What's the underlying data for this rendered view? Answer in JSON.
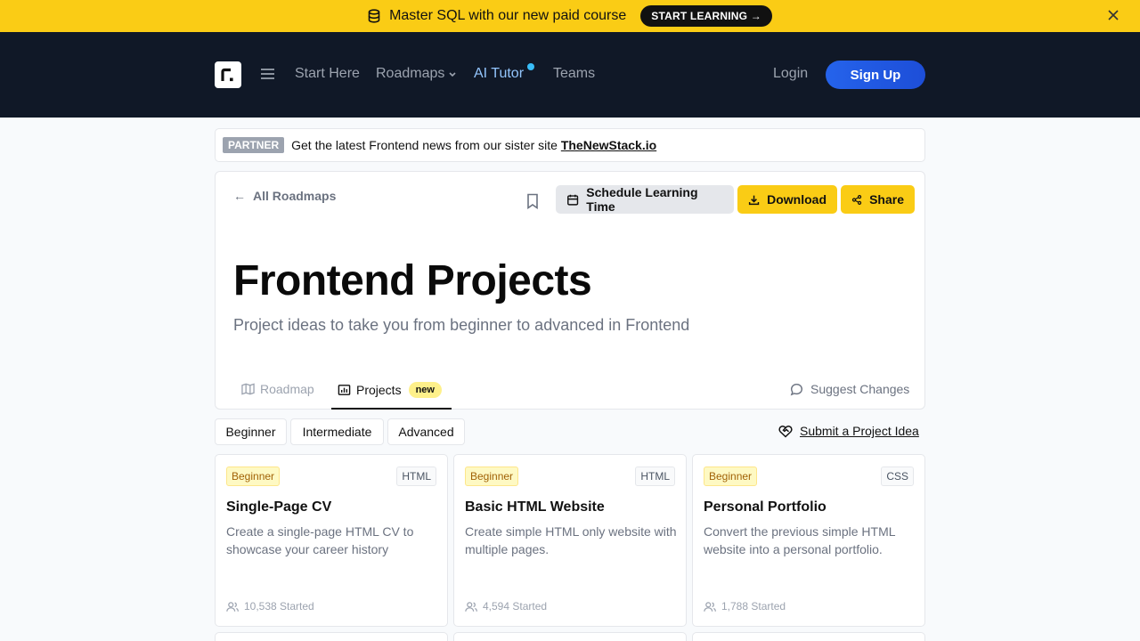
{
  "promo": {
    "text": "Master SQL with our new paid course",
    "button": "START LEARNING →"
  },
  "nav": {
    "links": [
      "Start Here",
      "Roadmaps",
      "AI Tutor",
      "Teams"
    ],
    "login": "Login",
    "signup": "Sign Up"
  },
  "partner": {
    "badge": "PARTNER",
    "text": "Get the latest Frontend news from our sister site ",
    "link": "TheNewStack.io"
  },
  "header": {
    "back": "All Roadmaps",
    "schedule": "Schedule Learning Time",
    "download": "Download",
    "share": "Share",
    "title": "Frontend Projects",
    "subtitle": "Project ideas to take you from beginner to advanced in Frontend"
  },
  "tabs": {
    "roadmap": "Roadmap",
    "projects": "Projects",
    "new_badge": "new",
    "suggest": "Suggest Changes"
  },
  "filters": [
    "Beginner",
    "Intermediate",
    "Advanced"
  ],
  "submit_idea": "Submit a Project Idea",
  "projects": [
    {
      "level": "Beginner",
      "tech": "HTML",
      "title": "Single-Page CV",
      "desc": "Create a single-page HTML CV to showcase your career history",
      "started": "10,538 Started"
    },
    {
      "level": "Beginner",
      "tech": "HTML",
      "title": "Basic HTML Website",
      "desc": "Create simple HTML only website with multiple pages.",
      "started": "4,594 Started"
    },
    {
      "level": "Beginner",
      "tech": "CSS",
      "title": "Personal Portfolio",
      "desc": "Convert the previous simple HTML website into a personal portfolio.",
      "started": "1,788 Started"
    }
  ],
  "colors": {
    "accent_yellow": "#facc15",
    "nav_bg": "#101827",
    "signup_blue": "#2563eb"
  }
}
